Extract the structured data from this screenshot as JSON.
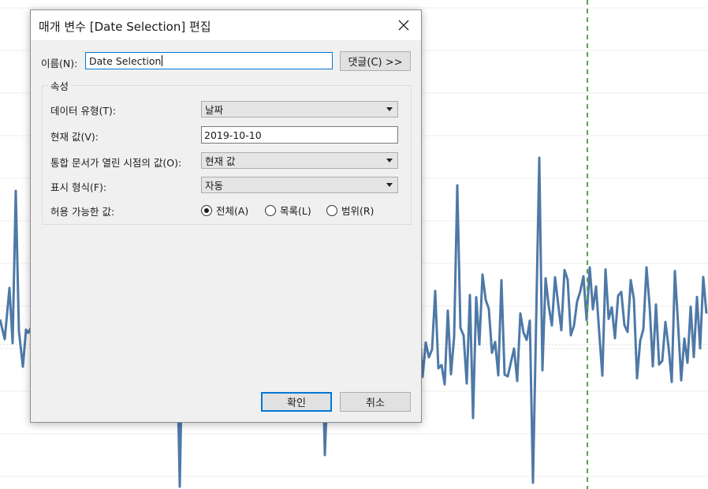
{
  "background_chart": {
    "line_color": "#4e79a7",
    "reference_line_color": "#59a14f"
  },
  "dialog": {
    "title": "매개 변수 [Date Selection] 편집",
    "name_label": "이름(N):",
    "name_value": "Date Selection",
    "comment_button": "댓글(C) >>",
    "group_label": "속성",
    "properties": {
      "data_type_label": "데이터 유형(T):",
      "data_type_value": "날짜",
      "current_value_label": "현재 값(V):",
      "current_value": "2019-10-10",
      "on_open_label": "통합 문서가 열린 시점의 값(O):",
      "on_open_value": "현재 값",
      "display_format_label": "표시 형식(F):",
      "display_format_value": "자동",
      "allowable_label": "허용 가능한 값:",
      "allowable_options": [
        "전체(A)",
        "목록(L)",
        "범위(R)"
      ],
      "allowable_selected": "전체(A)"
    },
    "ok_button": "확인",
    "cancel_button": "취소"
  }
}
